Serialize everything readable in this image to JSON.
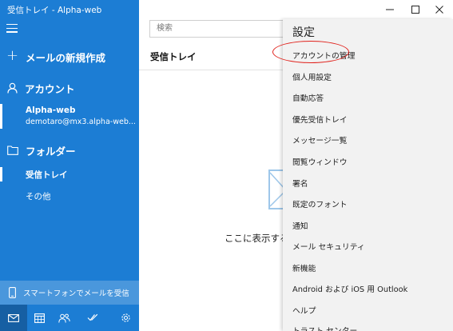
{
  "window": {
    "title": "受信トレイ - Alpha-web"
  },
  "left_pane": {
    "new_mail_label": "メールの新規作成",
    "accounts_label": "アカウント",
    "account": {
      "name": "Alpha-web",
      "email": "demotaro@mx3.alpha-web...."
    },
    "folders_label": "フォルダー",
    "folders": [
      {
        "label": "受信トレイ",
        "active": true
      },
      {
        "label": "その他",
        "active": false
      }
    ],
    "phone_promo_label": "スマートフォンでメールを受信",
    "bottom_icons": [
      "mail-icon",
      "calendar-icon",
      "people-icon",
      "todo-icon",
      "settings-gear-icon"
    ]
  },
  "middle_pane": {
    "search_placeholder": "検索",
    "folder_title": "受信トレイ",
    "empty_text": "ここに表示する"
  },
  "settings_pane": {
    "title": "設定",
    "items": [
      "アカウントの管理",
      "個人用設定",
      "自動応答",
      "優先受信トレイ",
      "メッセージ一覧",
      "閲覧ウィンドウ",
      "署名",
      "既定のフォント",
      "通知",
      "メール セキュリティ",
      "新機能",
      "Android および iOS 用 Outlook",
      "ヘルプ",
      "トラスト センター"
    ],
    "highlighted_item": "アカウントの管理"
  },
  "colors": {
    "left_pane_bg": "#1c7dd4",
    "phone_bar_bg": "#4a97dc",
    "settings_bg": "#f2f2f2",
    "highlight_oval": "#e0201a"
  }
}
